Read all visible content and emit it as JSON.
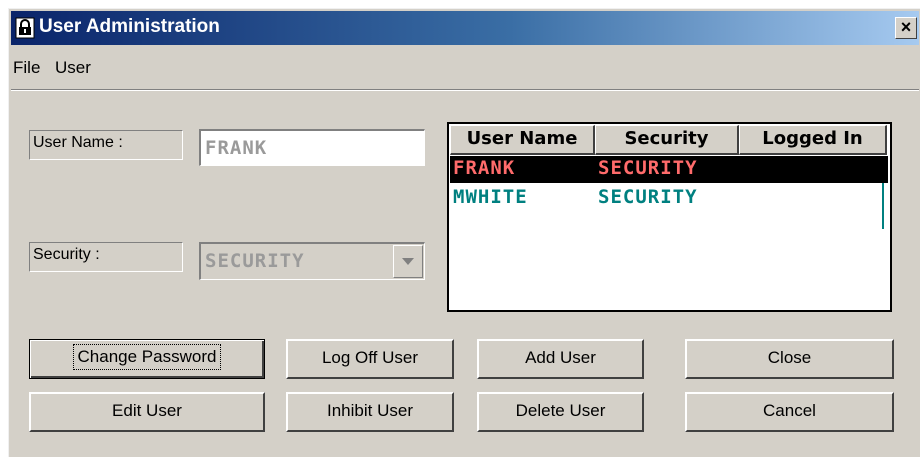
{
  "window": {
    "title": "User Administration",
    "close_glyph": "×"
  },
  "menu": {
    "items": [
      "File",
      "User"
    ]
  },
  "form": {
    "username_label": "User Name :",
    "username_value": "FRANK",
    "security_label": "Security :",
    "security_value": "SECURITY"
  },
  "users_table": {
    "columns": [
      "User Name",
      "Security",
      "Logged In"
    ],
    "rows": [
      {
        "user": "FRANK",
        "security": "SECURITY",
        "logged_in": "",
        "selected": true,
        "color": "#ff6b6b"
      },
      {
        "user": "MWHITE",
        "security": "SECURITY",
        "logged_in": "",
        "selected": false,
        "color": "#008080"
      }
    ]
  },
  "buttons": {
    "change_password": "Change Password",
    "log_off_user": "Log Off User",
    "add_user": "Add User",
    "close": "Close",
    "edit_user": "Edit User",
    "inhibit_user": "Inhibit User",
    "delete_user": "Delete User",
    "cancel": "Cancel"
  },
  "colors": {
    "face": "#d4d0c8",
    "title_start": "#0a246a",
    "title_end": "#a6caf0",
    "selected_row_bg": "#000000"
  }
}
